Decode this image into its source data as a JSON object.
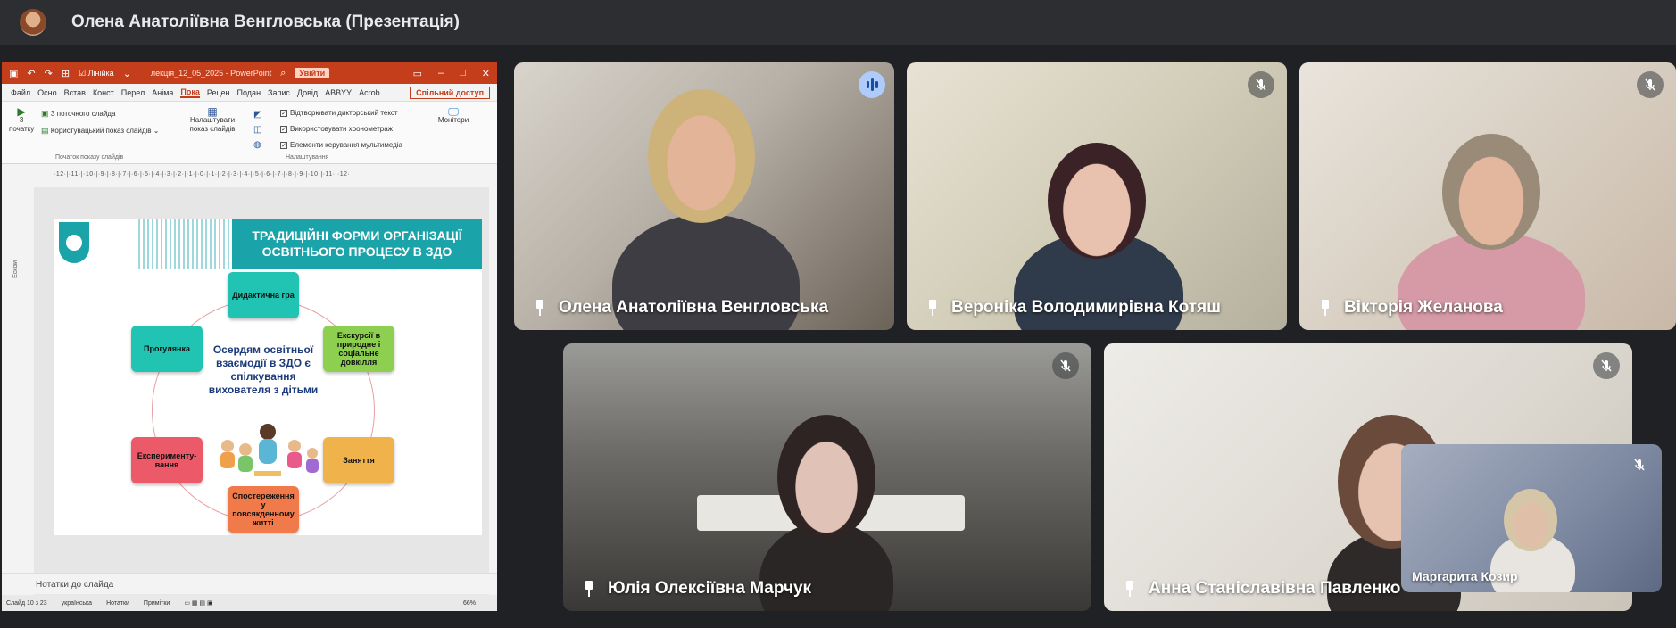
{
  "header": {
    "title": "Олена Анатоліївна Венгловська (Презентація)"
  },
  "ppt": {
    "ruler_toggle": "Лінійка",
    "doc_title": "лекція_12_05_2025 - PowerPoint",
    "signin": "Увійти",
    "tabs": [
      "Файл",
      "Осно",
      "Встав",
      "Конст",
      "Перел",
      "Аніма",
      "Пока",
      "Рецен",
      "Подан",
      "Запис",
      "Довід",
      "ABBYY",
      "Acrob"
    ],
    "active_tab": "Пока",
    "share": "Спільний доступ",
    "from_start": "З початку",
    "from_current": "З поточного слайда",
    "custom_show": "Користувацький показ слайдів",
    "setup_show": "Налаштувати показ слайдів",
    "opt_narration": "Відтворювати дикторський текст",
    "opt_timings": "Використовувати хронометраж",
    "opt_media": "Елементи керування мультимедіа",
    "monitors": "Монітори",
    "group_start": "Початок показу слайдів",
    "group_setup": "Налаштування",
    "ruler": "·12·|·11·|·10·|·9·|·8·|·7·|·6·|·5·|·4·|·3·|·2·|·1·|·0·|·1·|·2·|·3·|·4·|·5·|·6·|·7·|·8·|·9·|·10·|·11·|·12·",
    "sidebar_label": "Ескізи",
    "notes": "Нотатки до слайда",
    "status": {
      "slide": "Слайд 10 з 23",
      "lang": "українська",
      "notes": "Нотатки",
      "comments": "Примітки",
      "zoom": "66%"
    }
  },
  "slide": {
    "title": "ТРАДИЦІЙНІ ФОРМИ ОРГАНІЗАЦІЇ ОСВІТНЬОГО ПРОЦЕСУ В ЗДО",
    "center": "Осердям освітньої взаємодії в ЗДО є спілкування вихователя з дітьми",
    "nodes": [
      {
        "label": "Дидактична гра",
        "color": "#21c4b3"
      },
      {
        "label": "Екскурсії в природне і соціальне довкілля",
        "color": "#8dcf4e"
      },
      {
        "label": "Заняття",
        "color": "#f0b24a"
      },
      {
        "label": "Спостереження у повсякденному житті",
        "color": "#f07a4a"
      },
      {
        "label": "Експерименту-вання",
        "color": "#ec5a6a"
      },
      {
        "label": "Прогулянка",
        "color": "#21c4b3"
      }
    ]
  },
  "participants": [
    {
      "name": "Олена Анатоліївна Венгловська",
      "state": "speaking"
    },
    {
      "name": "Вероніка Володимирівна Котяш",
      "state": "muted"
    },
    {
      "name": "Вікторія Желанова",
      "state": "muted"
    },
    {
      "name": "Юлія Олексіївна Марчук",
      "state": "muted"
    },
    {
      "name": "Анна Станіславівна Павленко",
      "state": "muted"
    },
    {
      "name": "Маргарита Козир",
      "state": "muted"
    }
  ]
}
